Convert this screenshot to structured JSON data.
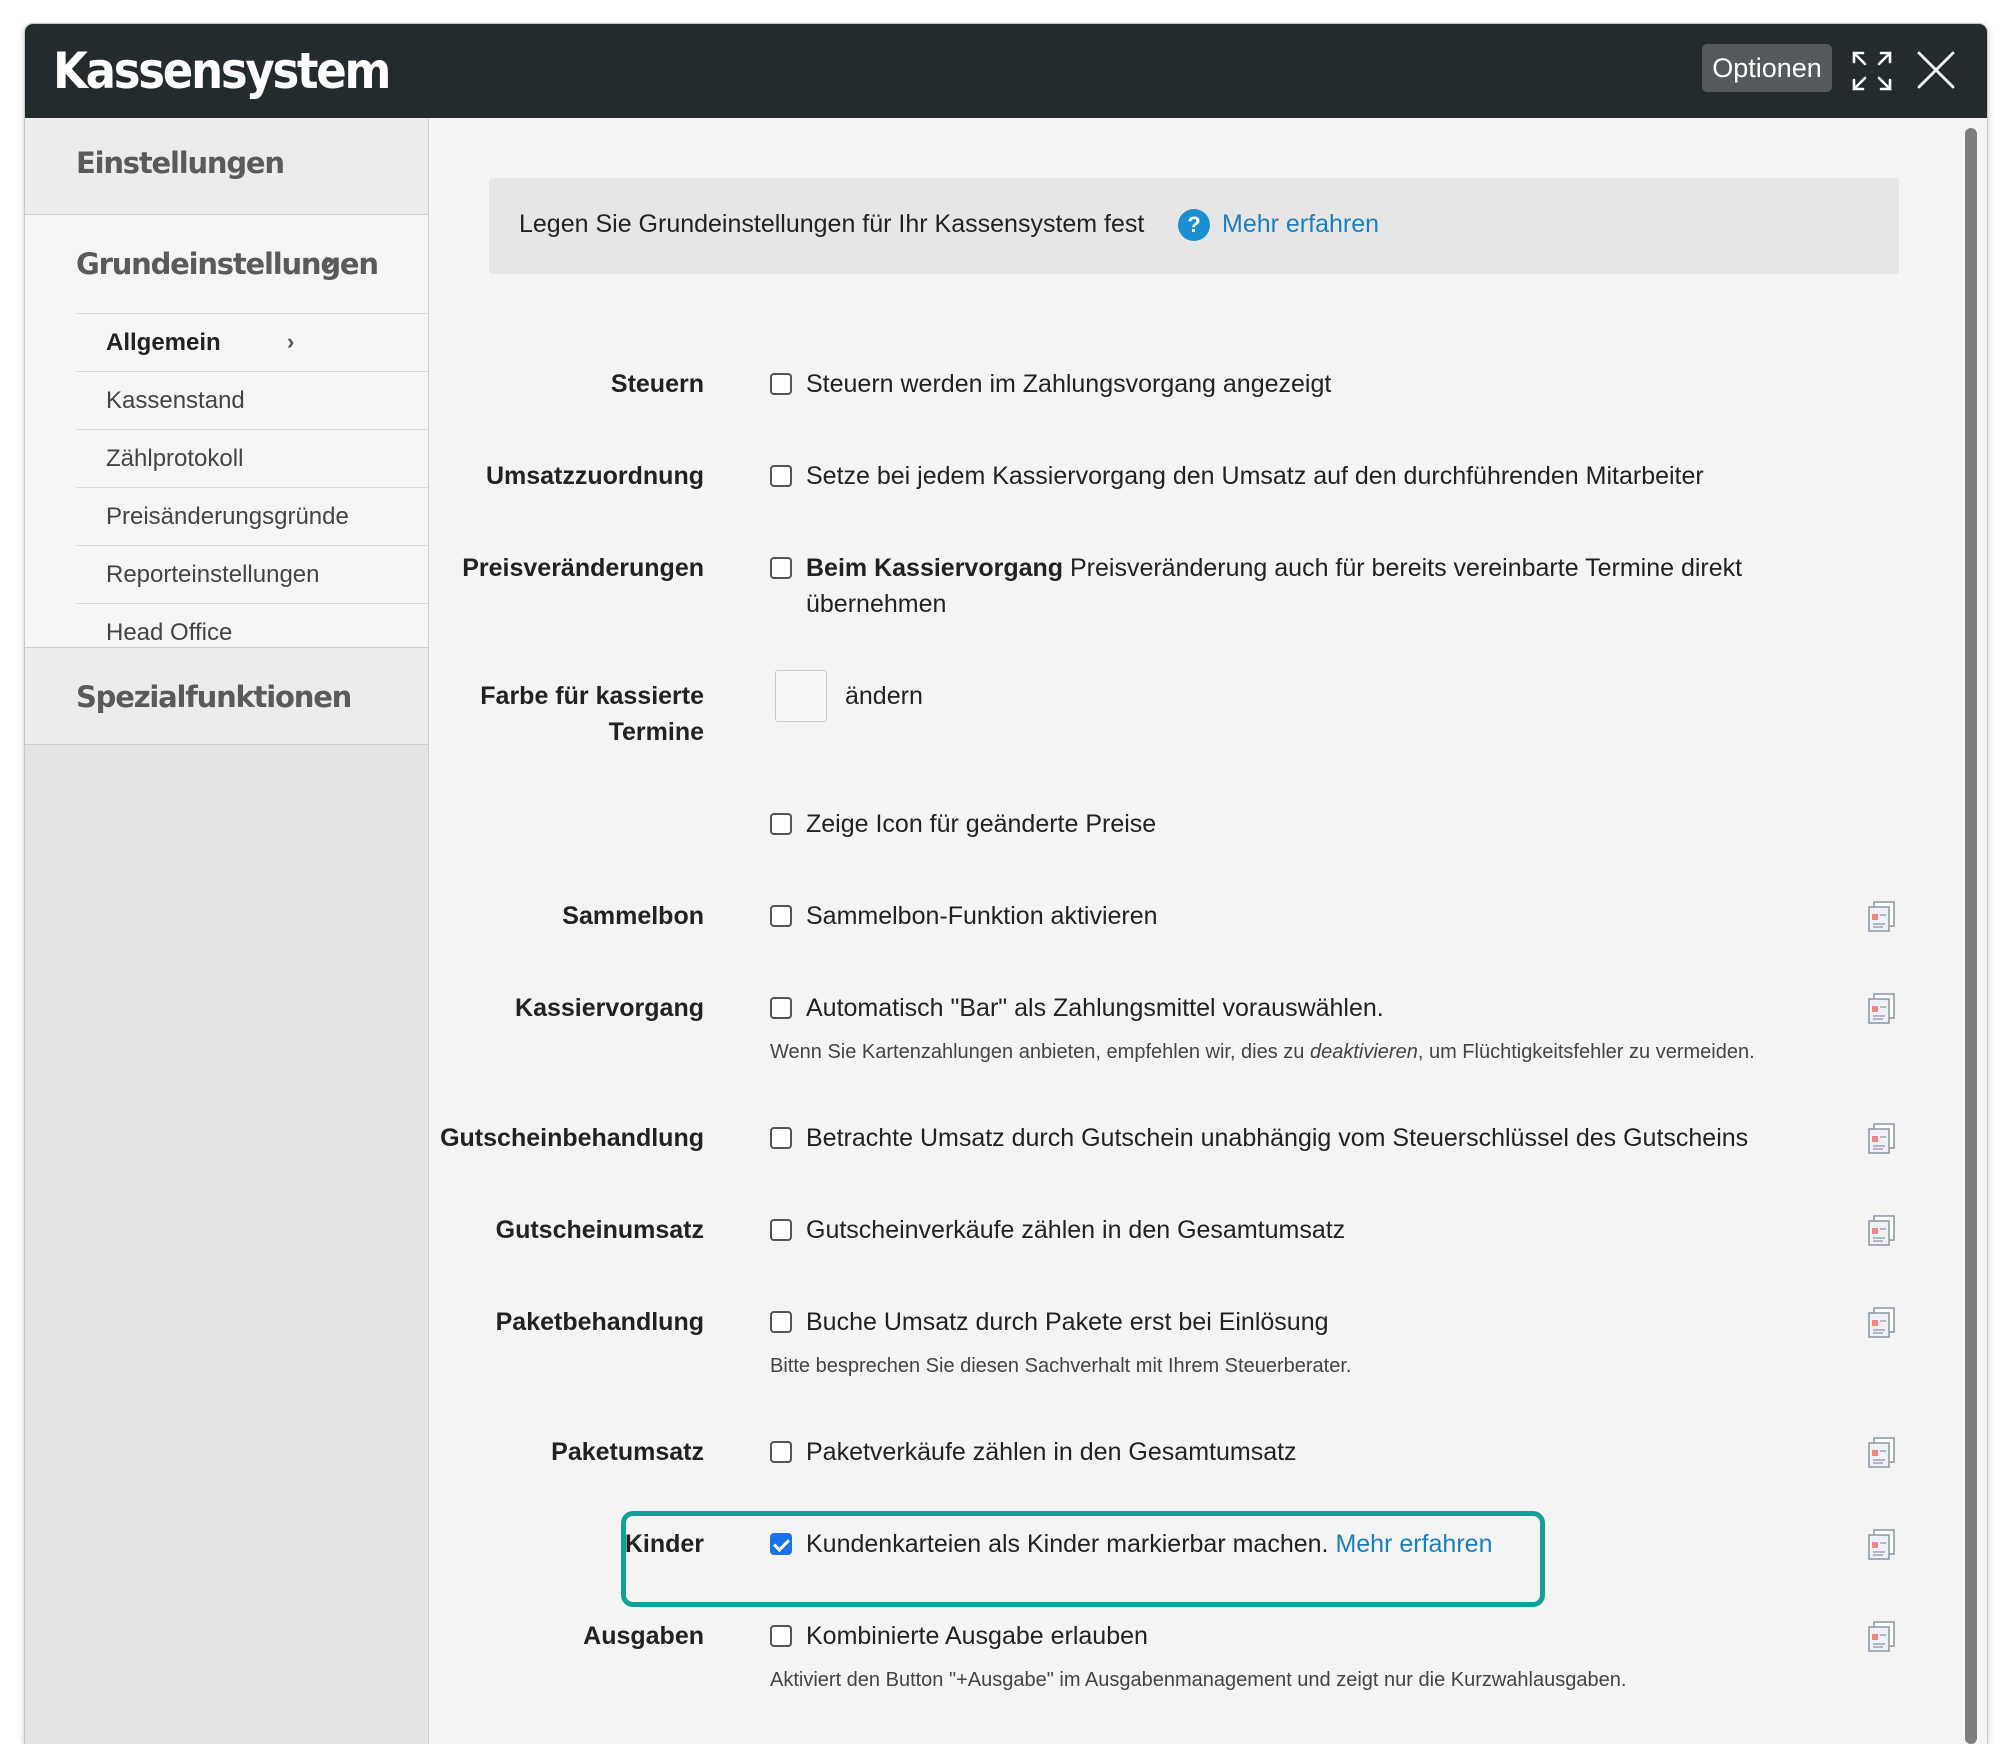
{
  "window": {
    "title": "Kassensystem",
    "options_label": "Optionen",
    "expand_icon": "expand-icon",
    "close_icon": "close-icon"
  },
  "sidebar": {
    "section_settings": "Einstellungen",
    "group_title": "Grundeinstellungen",
    "items": [
      {
        "label": "Allgemein",
        "active": true
      },
      {
        "label": "Kassenstand"
      },
      {
        "label": "Zählprotokoll"
      },
      {
        "label": "Preisänderungsgründe"
      },
      {
        "label": "Reporteinstellungen"
      },
      {
        "label": "Head Office"
      }
    ],
    "section_special": "Spezialfunktionen"
  },
  "info": {
    "text": "Legen Sie Grundeinstellungen für Ihr Kassensystem fest",
    "link": "Mehr erfahren"
  },
  "rows": {
    "steuern": {
      "label": "Steuern",
      "text": "Steuern werden im Zahlungsvorgang angezeigt",
      "checked": false
    },
    "umsatz": {
      "label": "Umsatzzuordnung",
      "text": "Setze bei jedem Kassiervorgang den Umsatz auf den durchführenden Mitarbeiter",
      "checked": false
    },
    "preis": {
      "label": "Preisveränderungen",
      "bold": "Beim Kassiervorgang",
      "text": " Preisveränderung auch für bereits vereinbarte Termine direkt übernehmen",
      "checked": false
    },
    "farbe": {
      "label": "Farbe für kassierte Termine",
      "link": "ändern"
    },
    "icon": {
      "text": "Zeige Icon für geänderte Preise",
      "checked": false
    },
    "sammelbon": {
      "label": "Sammelbon",
      "text": "Sammelbon-Funktion aktivieren",
      "checked": false
    },
    "kassier": {
      "label": "Kassiervorgang",
      "text": "Automatisch \"Bar\" als Zahlungsmittel vorauswählen.",
      "hint_a": "Wenn Sie Kartenzahlungen anbieten, empfehlen wir, dies zu ",
      "hint_em": "deaktivieren",
      "hint_b": ", um Flüchtigkeitsfehler zu vermeiden.",
      "checked": false
    },
    "gutschein": {
      "label": "Gutscheinbehandlung",
      "text": "Betrachte Umsatz durch Gutschein unabhängig vom Steuerschlüssel des Gutscheins",
      "checked": false
    },
    "gutscheinumsatz": {
      "label": "Gutscheinumsatz",
      "text": "Gutscheinverkäufe zählen in den Gesamtumsatz",
      "checked": false
    },
    "paket": {
      "label": "Paketbehandlung",
      "text": "Buche Umsatz durch Pakete erst bei Einlösung",
      "hint": "Bitte besprechen Sie diesen Sachverhalt mit Ihrem Steuerberater.",
      "checked": false
    },
    "paketumsatz": {
      "label": "Paketumsatz",
      "text": "Paketverkäufe zählen in den Gesamtumsatz",
      "checked": false
    },
    "kinder": {
      "label": "Kinder",
      "text": "Kundenkarteien als Kinder markierbar machen.",
      "link": "Mehr erfahren",
      "checked": true
    },
    "ausgaben": {
      "label": "Ausgaben",
      "text": "Kombinierte Ausgabe erlauben",
      "hint": "Aktiviert den Button \"+Ausgabe\" im Ausgabenmanagement und zeigt nur die Kurzwahlausgaben.",
      "checked": false
    }
  },
  "colors": {
    "titlebar": "#242b2f",
    "link": "#1a7fc1",
    "highlight": "#12a198",
    "checkbox_checked": "#1a73e8"
  }
}
